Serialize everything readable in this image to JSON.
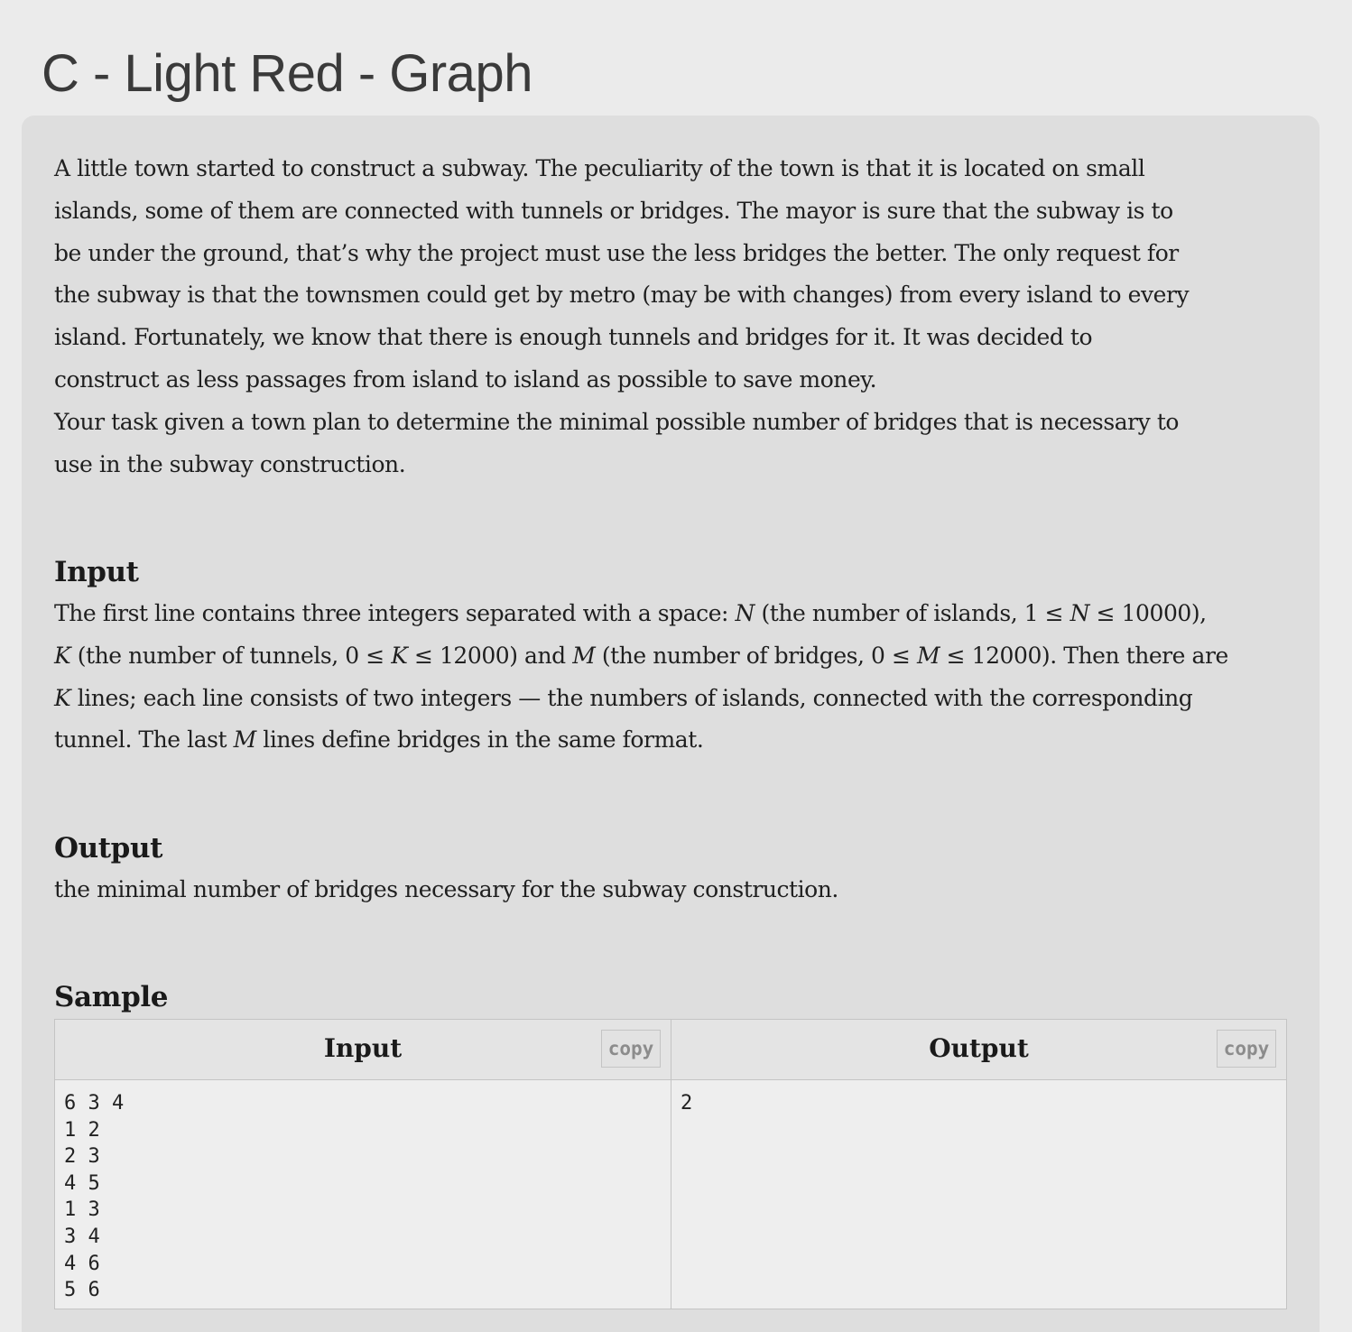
{
  "title": "C - Light Red - Graph",
  "statement": {
    "lines": [
      "A little town started to construct a subway. The peculiarity of the town is that it is located on small",
      "islands, some of them are connected with tunnels or bridges. The mayor is sure that the subway is to",
      "be under the ground, that’s why the project must use the less bridges the better. The only request for",
      "the subway is that the townsmen could get by metro (may be with changes) from every island to every",
      "island. Fortunately, we know that there is enough tunnels and bridges for it. It was decided to",
      "construct as less passages from island to island as possible to save money.",
      "Your task given a town plan to determine the minimal possible number of bridges that is necessary to",
      "use in the subway construction."
    ]
  },
  "input_section": {
    "heading": "Input",
    "line1": {
      "a": "The first line contains three integers separated with a space: ",
      "v1": "N",
      "b": " (the number of islands, 1 ≤ ",
      "v2": "N",
      "c": " ≤ 10000),"
    },
    "line2": {
      "v1": "K",
      "a": " (the number of tunnels, 0 ≤ ",
      "v2": "K",
      "b": " ≤ 12000) and ",
      "v3": "M",
      "c": " (the number of bridges, 0 ≤ ",
      "v4": "M",
      "d": " ≤ 12000). Then there are"
    },
    "line3": {
      "v1": "K",
      "a": " lines; each line consists of two integers — the numbers of islands, connected with the corresponding"
    },
    "line4": {
      "a": "tunnel. The last ",
      "v1": "M",
      "b": " lines define bridges in the same format."
    }
  },
  "output_section": {
    "heading": "Output",
    "text": "the minimal number of bridges necessary for the subway construction."
  },
  "sample": {
    "heading": "Sample",
    "input_label": "Input",
    "output_label": "Output",
    "copy_label": "copy",
    "input_text": "6 3 4\n1 2\n2 3\n4 5\n1 3\n3 4\n4 6\n5 6",
    "output_text": "2"
  }
}
